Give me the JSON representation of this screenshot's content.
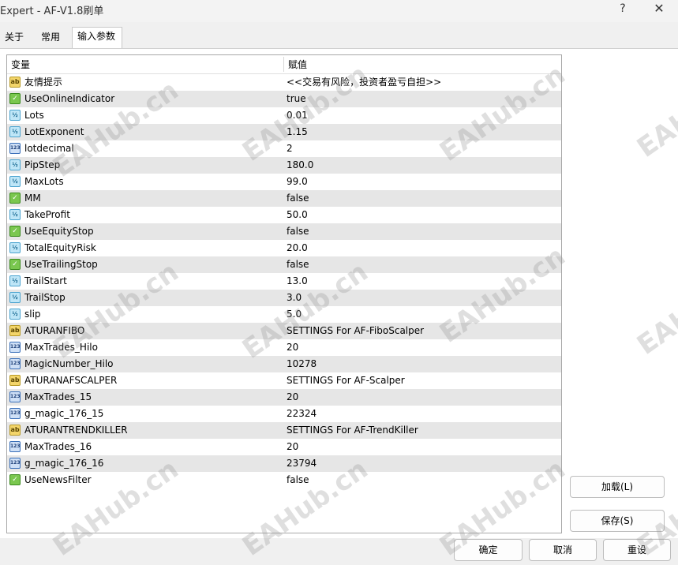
{
  "window": {
    "title": "Expert - AF-V1.8刷单",
    "help_label": "?",
    "close_label": "✕"
  },
  "tabs": [
    {
      "label": "关于"
    },
    {
      "label": "常用"
    },
    {
      "label": "输入参数"
    }
  ],
  "grid": {
    "headers": {
      "variable": "变量",
      "value": "赋值"
    },
    "rows": [
      {
        "icon": "ab",
        "name": "友情提示",
        "value": "<<交易有风险，投资者盈亏自担>>"
      },
      {
        "icon": "bool",
        "name": "UseOnlineIndicator",
        "value": "true"
      },
      {
        "icon": "half",
        "name": "Lots",
        "value": "0.01"
      },
      {
        "icon": "half",
        "name": "LotExponent",
        "value": "1.15"
      },
      {
        "icon": "123",
        "name": "lotdecimal",
        "value": "2"
      },
      {
        "icon": "half",
        "name": "PipStep",
        "value": "180.0"
      },
      {
        "icon": "half",
        "name": "MaxLots",
        "value": "99.0"
      },
      {
        "icon": "bool",
        "name": "MM",
        "value": "false"
      },
      {
        "icon": "half",
        "name": "TakeProfit",
        "value": "50.0"
      },
      {
        "icon": "bool",
        "name": "UseEquityStop",
        "value": "false"
      },
      {
        "icon": "half",
        "name": "TotalEquityRisk",
        "value": "20.0"
      },
      {
        "icon": "bool",
        "name": "UseTrailingStop",
        "value": "false"
      },
      {
        "icon": "half",
        "name": "TrailStart",
        "value": "13.0"
      },
      {
        "icon": "half",
        "name": "TrailStop",
        "value": "3.0"
      },
      {
        "icon": "half",
        "name": "slip",
        "value": "5.0"
      },
      {
        "icon": "ab",
        "name": "ATURANFIBO",
        "value": "SETTINGS For AF-FiboScalper"
      },
      {
        "icon": "123",
        "name": "MaxTrades_Hilo",
        "value": "20"
      },
      {
        "icon": "123",
        "name": "MagicNumber_Hilo",
        "value": "10278"
      },
      {
        "icon": "ab",
        "name": "ATURANAFSCALPER",
        "value": "SETTINGS For AF-Scalper"
      },
      {
        "icon": "123",
        "name": "MaxTrades_15",
        "value": "20"
      },
      {
        "icon": "123",
        "name": "g_magic_176_15",
        "value": "22324"
      },
      {
        "icon": "ab",
        "name": "ATURANTRENDKILLER",
        "value": "SETTINGS For AF-TrendKiller"
      },
      {
        "icon": "123",
        "name": "MaxTrades_16",
        "value": "20"
      },
      {
        "icon": "123",
        "name": "g_magic_176_16",
        "value": "23794"
      },
      {
        "icon": "bool",
        "name": "UseNewsFilter",
        "value": "false"
      }
    ]
  },
  "icon_glyphs": {
    "ab": "ab",
    "half": "½",
    "123": "123",
    "bool": "✓"
  },
  "buttons": {
    "load": "加载(L)",
    "save": "保存(S)",
    "ok": "确定",
    "cancel": "取消",
    "reset": "重设"
  },
  "watermark": "EAHub.cn"
}
